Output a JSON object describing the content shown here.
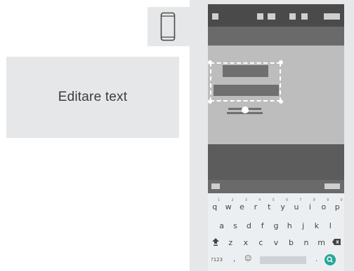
{
  "label": {
    "text": "Editare text"
  },
  "keyboard": {
    "row1": [
      {
        "k": "q",
        "s": "1"
      },
      {
        "k": "w",
        "s": "2"
      },
      {
        "k": "e",
        "s": "3"
      },
      {
        "k": "r",
        "s": "4"
      },
      {
        "k": "t",
        "s": "5"
      },
      {
        "k": "y",
        "s": "6"
      },
      {
        "k": "u",
        "s": "7"
      },
      {
        "k": "i",
        "s": "8"
      },
      {
        "k": "o",
        "s": "9"
      },
      {
        "k": "p",
        "s": "0"
      }
    ],
    "row2": [
      "a",
      "s",
      "d",
      "f",
      "g",
      "h",
      "j",
      "k",
      "l"
    ],
    "row3": [
      "z",
      "x",
      "c",
      "v",
      "b",
      "n",
      "m"
    ],
    "symbols_label": "?123",
    "comma": ",",
    "period": ".",
    "emoji": "☺"
  },
  "colors": {
    "accent": "#26a69a",
    "frame": "#e6e7e9"
  },
  "icons": [
    "phone-icon",
    "shift-icon",
    "backspace-icon",
    "emoji-icon",
    "search-icon"
  ]
}
